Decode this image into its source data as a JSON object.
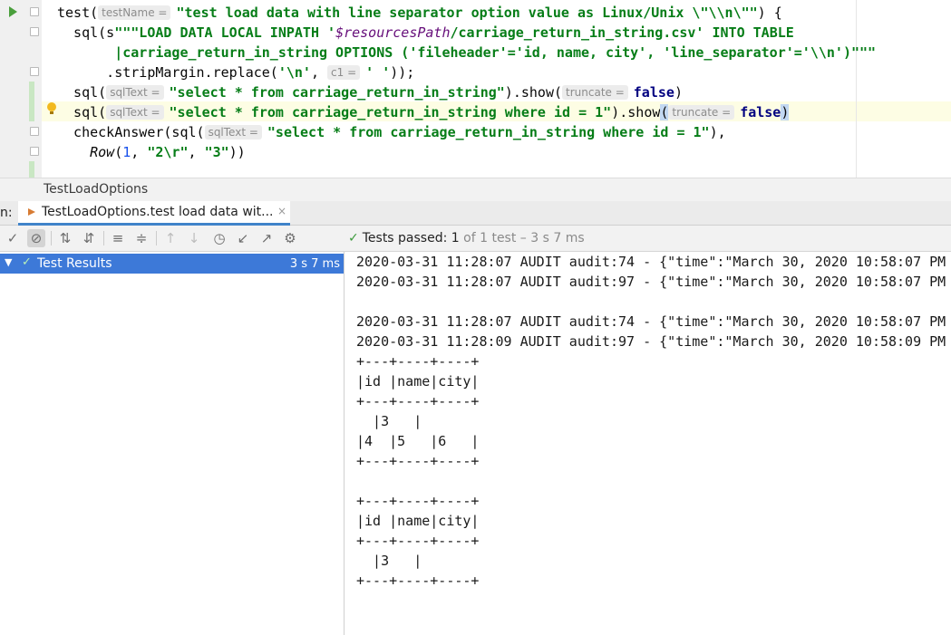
{
  "editor": {
    "hints": {
      "testName": "testName =",
      "sqlText": "sqlText =",
      "c1": "c1 =",
      "truncate": "truncate ="
    },
    "line1": {
      "pre": "test(",
      "str": "\"test load data with line separator option value as Linux/Unix \\\"\\\\n\\\"\"",
      "post": ") {"
    },
    "line2": {
      "pre": "  sql(s",
      "str_a": "\"\"\"LOAD DATA LOCAL INPATH '",
      "var": "$resourcesPath",
      "str_b": "/carriage_return_in_string.csv' INTO TABLE"
    },
    "line3": {
      "str": "       |carriage_return_in_string OPTIONS ('fileheader'='id, name, city', 'line_separator'='\\\\n')\"\"\""
    },
    "line4": {
      "pre": "      .stripMargin.replace(",
      "str_a": "'\\n'",
      "mid": ", ",
      "str_b": "' '",
      "post": "));"
    },
    "line5": {
      "pre": "  sql(",
      "str": "\"select * from carriage_return_in_string\"",
      "mid": ").show(",
      "kw": "false",
      "post": ")"
    },
    "line6": {
      "pre": "  sql(",
      "str": "\"select * from carriage_return_in_string where id = 1\"",
      "mid": ").show",
      "open": "(",
      "kw": "false",
      "close": ")"
    },
    "line7": {
      "pre": "  checkAnswer(sql(",
      "str": "\"select * from carriage_return_in_string where id = 1\"",
      "post": "),"
    },
    "line8": {
      "pre": "    ",
      "fn": "Row",
      "a": "(",
      "n1": "1",
      "b": ", ",
      "s1": "\"2\\r\"",
      "c": ", ",
      "s2": "\"3\"",
      "d": "))"
    }
  },
  "breadcrumb": "TestLoadOptions",
  "run_tab": {
    "prefix": "n:",
    "label": "TestLoadOptions.test load data wit...",
    "close": "×"
  },
  "toolbar": {
    "icons": [
      "checkmark-icon",
      "stop-icon",
      "sort-alpha-icon",
      "sort-duration-icon",
      "expand-all-icon",
      "collapse-all-icon",
      "prev-failed-icon",
      "next-failed-icon",
      "history-icon",
      "import-icon",
      "export-icon",
      "settings-icon"
    ],
    "status_label": "Tests passed:",
    "status_count": "1",
    "status_rest": "of 1 test – 3 s 7 ms"
  },
  "results": {
    "label": "Test Results",
    "time": "3 s 7 ms"
  },
  "console": {
    "lines": [
      "2020-03-31 11:28:07 AUDIT audit:74 - {\"time\":\"March 30, 2020 10:58:07 PM",
      "2020-03-31 11:28:07 AUDIT audit:97 - {\"time\":\"March 30, 2020 10:58:07 PM",
      "",
      "2020-03-31 11:28:07 AUDIT audit:74 - {\"time\":\"March 30, 2020 10:58:07 PM",
      "2020-03-31 11:28:09 AUDIT audit:97 - {\"time\":\"March 30, 2020 10:58:09 PM",
      "+---+----+----+",
      "|id |name|city|",
      "+---+----+----+",
      "  |3   |",
      "|4  |5   |6   |",
      "+---+----+----+",
      "",
      "+---+----+----+",
      "|id |name|city|",
      "+---+----+----+",
      "  |3   |",
      "+---+----+----+"
    ]
  },
  "colors": {
    "selection": "#3d79d8",
    "string": "#067d17",
    "keyword": "#000080",
    "pass": "#3c9a3c"
  }
}
